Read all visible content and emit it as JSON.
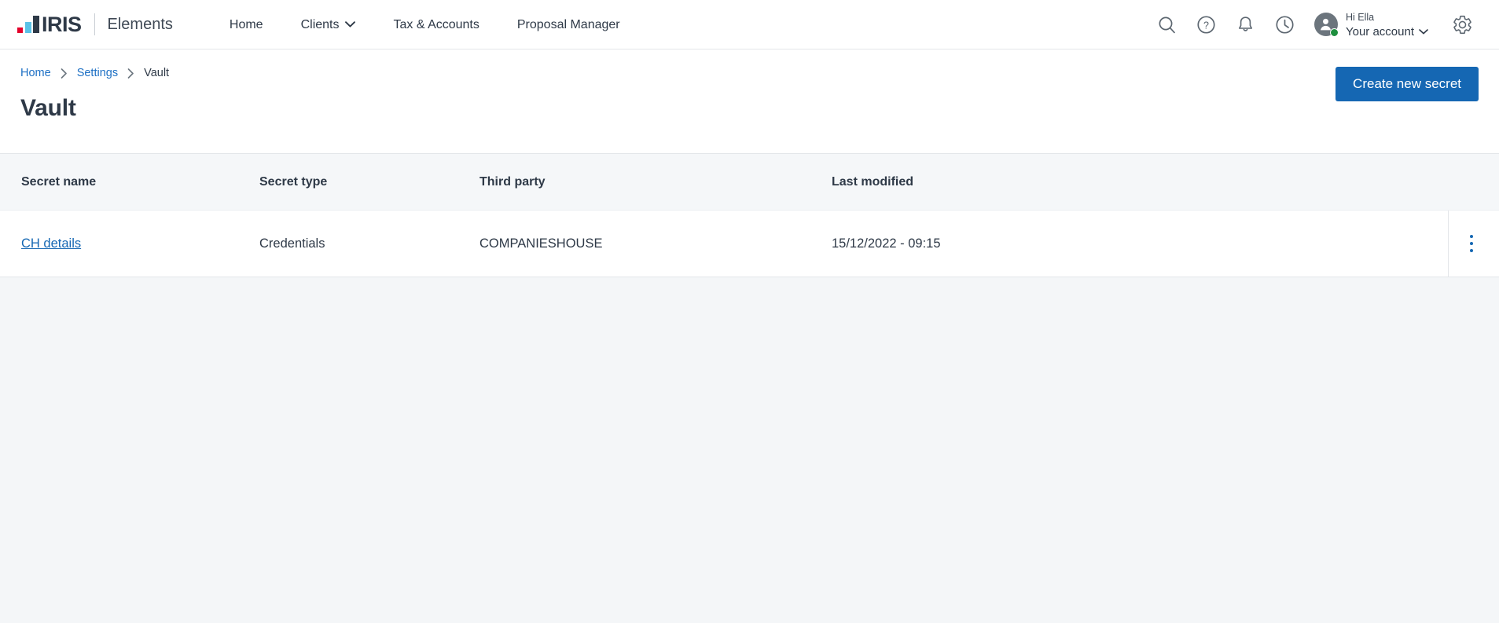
{
  "brand": {
    "logo_text": "IRIS",
    "product": "Elements",
    "colors": {
      "red": "#e4002b",
      "blue": "#5bc2e7",
      "navy": "#2e3947"
    }
  },
  "nav": {
    "items": [
      {
        "label": "Home",
        "has_dropdown": false
      },
      {
        "label": "Clients",
        "has_dropdown": true
      },
      {
        "label": "Tax & Accounts",
        "has_dropdown": false
      },
      {
        "label": "Proposal Manager",
        "has_dropdown": false
      }
    ]
  },
  "topbar_actions": {
    "search": "search-icon",
    "help": "help-circle-icon",
    "notifications": "bell-icon",
    "history": "clock-icon",
    "settings": "gear-icon"
  },
  "account": {
    "greeting": "Hi Ella",
    "label": "Your account",
    "chevron": "chevron-down-icon",
    "status_color": "#1e8f3e"
  },
  "breadcrumb": {
    "items": [
      {
        "label": "Home",
        "is_link": true
      },
      {
        "label": "Settings",
        "is_link": true
      },
      {
        "label": "Vault",
        "is_link": false
      }
    ],
    "separator": "›"
  },
  "page": {
    "title": "Vault",
    "primary_action": "Create new secret",
    "accent_color": "#1567b3"
  },
  "table": {
    "columns": [
      {
        "key": "secret_name",
        "label": "Secret name"
      },
      {
        "key": "secret_type",
        "label": "Secret type"
      },
      {
        "key": "third_party",
        "label": "Third party"
      },
      {
        "key": "last_modified",
        "label": "Last modified"
      }
    ],
    "rows": [
      {
        "secret_name": "CH details",
        "secret_type": "Credentials",
        "third_party": "COMPANIESHOUSE",
        "last_modified": "15/12/2022 - 09:15",
        "row_menu": "kebab-menu-icon"
      }
    ]
  }
}
